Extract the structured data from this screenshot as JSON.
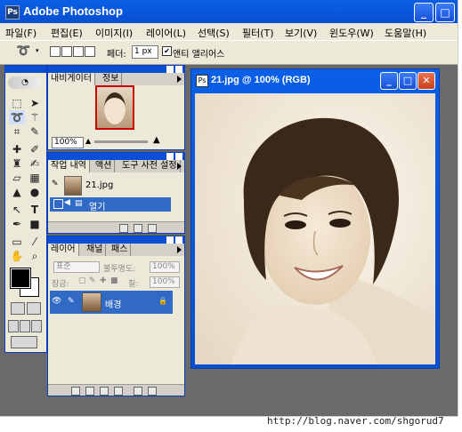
{
  "app": {
    "title": "Adobe Photoshop",
    "icon_glyph": "Ps",
    "minimize_glyph": "_",
    "maximize_glyph": "□"
  },
  "menubar": {
    "items": [
      "파일(F)",
      "편집(E)",
      "이미지(I)",
      "레이어(L)",
      "선택(S)",
      "필터(T)",
      "보기(V)",
      "윈도우(W)",
      "도움말(H)"
    ]
  },
  "options": {
    "tool_icon": "lasso-icon",
    "feather_label": "페더:",
    "feather_value": "1 px",
    "antialias_checked": true,
    "antialias_label": "앤티 앨리어스"
  },
  "toolbox": {
    "tools": [
      "rect-marquee",
      "move",
      "lasso",
      "magic-wand",
      "crop",
      "slice",
      "healing",
      "brush",
      "stamp",
      "history-brush",
      "eraser",
      "gradient",
      "blur",
      "dodge",
      "path-select",
      "type",
      "pen",
      "shape",
      "notes",
      "eyedropper",
      "hand",
      "zoom"
    ]
  },
  "navigator": {
    "tabs": [
      "내비게이터",
      "정보"
    ],
    "zoom": "100%"
  },
  "history": {
    "tabs": [
      "작업 내역",
      "액션",
      "도구 사전 설정"
    ],
    "snapshot_name": "21.jpg",
    "state_name": "열기"
  },
  "layers": {
    "tabs": [
      "레이어",
      "채널",
      "패스"
    ],
    "blend_mode": "표준",
    "opacity_label": "불투명도:",
    "opacity_value": "100%",
    "lock_label": "잠금:",
    "fill_label": "칠:",
    "fill_value": "100%",
    "layer_name": "배경",
    "lock_glyph": "🔒"
  },
  "document": {
    "title": "21.jpg @ 100% (RGB)",
    "tone": "sepia"
  },
  "watermark": "http://blog.naver.com/shgorud7",
  "colors": {
    "titlebar": "#0a4fd0",
    "panel_bg": "#ece9d8",
    "workspace": "#6a6a6a",
    "selection": "#316ac5",
    "close_button": "#d5532f"
  }
}
